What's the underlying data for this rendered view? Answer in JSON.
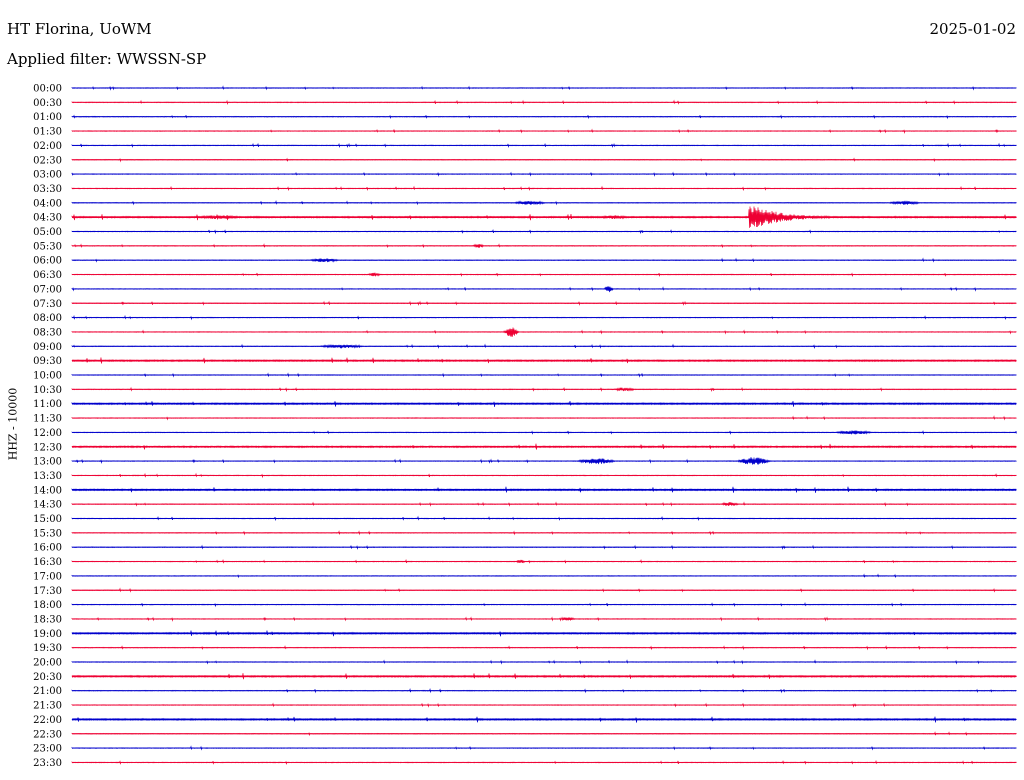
{
  "header": {
    "station": "HT Florina, UoWM",
    "date": "2025-01-02",
    "filter_text": "Applied filter: WWSSN-SP",
    "channel": "HHZ - 10000"
  },
  "colors": {
    "even_hour_trace": "#0000cc",
    "half_hour_trace": "#ee0033",
    "background": "#ffffff",
    "text": "#000000"
  },
  "chart_data": {
    "type": "line",
    "title": "",
    "ylabel": "HHZ - 10000",
    "row_labels": [
      "00:00",
      "00:30",
      "01:00",
      "01:30",
      "02:00",
      "02:30",
      "03:00",
      "03:30",
      "04:00",
      "04:30",
      "05:00",
      "05:30",
      "06:00",
      "06:30",
      "07:00",
      "07:30",
      "08:00",
      "08:30",
      "09:00",
      "09:30",
      "10:00",
      "10:30",
      "11:00",
      "11:30",
      "12:00",
      "12:30",
      "13:00",
      "13:30",
      "14:00",
      "14:30",
      "15:00",
      "15:30",
      "16:00",
      "16:30",
      "17:00",
      "17:30",
      "18:00",
      "18:30",
      "19:00",
      "19:30",
      "20:00",
      "20:30",
      "21:00",
      "21:30",
      "22:00",
      "22:30",
      "23:00",
      "23:30"
    ],
    "row_minutes": 30,
    "grid": false,
    "noise_level": [
      1,
      1,
      1,
      1,
      1,
      1,
      1,
      1,
      1,
      2,
      1,
      1,
      1,
      1,
      1,
      1,
      1,
      1,
      1,
      2,
      1,
      1,
      2,
      1,
      1,
      2,
      1,
      1,
      2,
      1,
      1,
      1,
      1,
      1,
      1,
      1,
      1,
      1,
      2,
      1,
      1,
      2,
      1,
      1,
      2,
      1,
      1,
      1
    ],
    "events": [
      {
        "row": "04:00",
        "start_min": 14.0,
        "end_min": 15.1,
        "amplitude": 2
      },
      {
        "row": "04:00",
        "start_min": 25.9,
        "end_min": 27.0,
        "amplitude": 2
      },
      {
        "row": "04:30",
        "start_min": 3.9,
        "end_min": 5.5,
        "amplitude": 2
      },
      {
        "row": "04:30",
        "start_min": 16.7,
        "end_min": 17.7,
        "amplitude": 2
      },
      {
        "row": "04:30",
        "start_min": 21.5,
        "end_min": 24.5,
        "amplitude": 14
      },
      {
        "row": "05:30",
        "start_min": 12.7,
        "end_min": 13.1,
        "amplitude": 2
      },
      {
        "row": "06:00",
        "start_min": 7.5,
        "end_min": 8.5,
        "amplitude": 2
      },
      {
        "row": "06:30",
        "start_min": 9.4,
        "end_min": 9.8,
        "amplitude": 2
      },
      {
        "row": "07:00",
        "start_min": 16.9,
        "end_min": 17.2,
        "amplitude": 4
      },
      {
        "row": "08:30",
        "start_min": 13.7,
        "end_min": 14.2,
        "amplitude": 5
      },
      {
        "row": "09:00",
        "start_min": 7.8,
        "end_min": 9.3,
        "amplitude": 2
      },
      {
        "row": "10:30",
        "start_min": 17.2,
        "end_min": 17.9,
        "amplitude": 2
      },
      {
        "row": "12:00",
        "start_min": 24.2,
        "end_min": 25.5,
        "amplitude": 2
      },
      {
        "row": "13:00",
        "start_min": 16.0,
        "end_min": 17.3,
        "amplitude": 3
      },
      {
        "row": "13:00",
        "start_min": 21.1,
        "end_min": 22.2,
        "amplitude": 4
      },
      {
        "row": "14:30",
        "start_min": 20.6,
        "end_min": 21.2,
        "amplitude": 2
      },
      {
        "row": "16:30",
        "start_min": 14.1,
        "end_min": 14.4,
        "amplitude": 2
      },
      {
        "row": "18:30",
        "start_min": 15.5,
        "end_min": 16.0,
        "amplitude": 2
      }
    ]
  }
}
